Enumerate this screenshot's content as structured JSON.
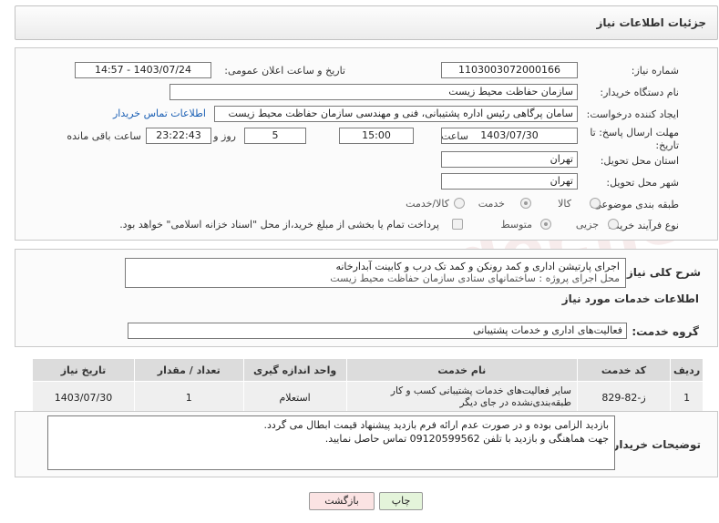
{
  "header": {
    "title": "جزئیات اطلاعات نیاز"
  },
  "fields": {
    "need_number_label": "شماره نیاز:",
    "need_number": "1103003072000166",
    "announce_label": "تاریخ و ساعت اعلان عمومی:",
    "announce_value": "1403/07/24 - 14:57",
    "buyer_org_label": "نام دستگاه خریدار:",
    "buyer_org": "سازمان حفاظت محیط زیست",
    "requester_label": "ایجاد کننده درخواست:",
    "requester": "سامان پرگاهی رئیس اداره پشتیبانی، فنی و مهندسی سازمان حفاظت محیط زیست",
    "buyer_contact_link": "اطلاعات تماس خریدار",
    "deadline_label": "مهلت ارسال پاسخ: تا تاریخ:",
    "deadline_date": "1403/07/30",
    "time_label": "ساعت",
    "deadline_time": "15:00",
    "days_value": "5",
    "days_label": "روز و",
    "remaining_time": "23:22:43",
    "remaining_label": "ساعت باقی مانده",
    "province_label": "استان محل تحویل:",
    "province": "تهران",
    "city_label": "شهر محل تحویل:",
    "city": "تهران",
    "category_label": "طبقه بندی موضوعی:",
    "category_options": [
      "کالا",
      "خدمت",
      "کالا/خدمت"
    ],
    "category_selected": "خدمت",
    "process_label": "نوع فرآیند خرید :",
    "process_options": [
      "جزیی",
      "متوسط"
    ],
    "process_selected": "متوسط",
    "treasury_note": "پرداخت تمام یا بخشی از مبلغ خرید،از محل \"اسناد خزانه اسلامی\" خواهد بود."
  },
  "summary": {
    "label": "شرح کلی نیاز:",
    "line1": "اجرای پارتیشن اداری و کمد رونکن و کمد تک درب و کابینت آبدارخانه",
    "line2": "محل اجرای پروژه : ساختمانهای ستادی سازمان حفاظت محیط زیست"
  },
  "services": {
    "section_title": "اطلاعات خدمات مورد نیاز",
    "group_label": "گروه خدمت:",
    "group_value": "فعالیت‌های اداری و خدمات پشتیبانی",
    "columns": [
      "ردیف",
      "کد خدمت",
      "نام خدمت",
      "واحد اندازه گیری",
      "تعداد / مقدار",
      "تاریخ نیاز"
    ],
    "rows": [
      [
        "1",
        "ز-82-829",
        "سایر فعالیت‌های خدمات پشتیبانی کسب و کار طبقه‌بندی‌نشده در جای دیگر",
        "استعلام",
        "1",
        "1403/07/30"
      ]
    ]
  },
  "buyer_notes": {
    "label": "توضیحات خریدار:",
    "line1": "بازدید الزامی بوده و در صورت عدم ارائه فرم بازدید پیشنهاد قیمت ابطال می گردد.",
    "line2": "جهت هماهنگی و بازدید با تلفن 09120599562 تماس حاصل نمایید."
  },
  "buttons": {
    "print": "چاپ",
    "back": "بازگشت"
  },
  "colors": {
    "link": "#1a5fb4",
    "back_button_bg": "#fbe3e3",
    "print_button_bg": "#e4f4da"
  }
}
